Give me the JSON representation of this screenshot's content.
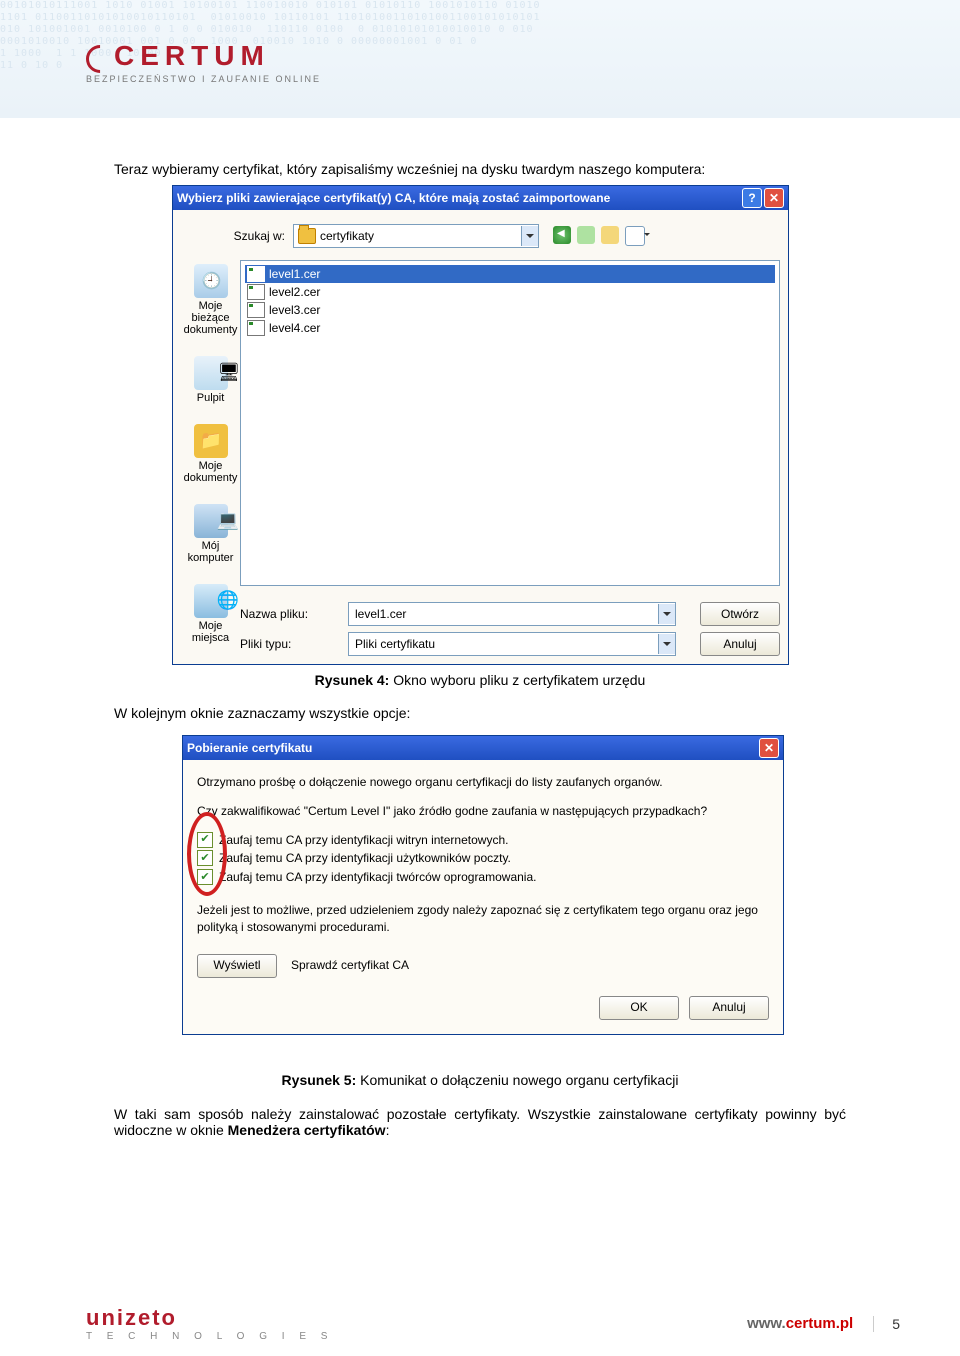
{
  "brand": {
    "certum": "CERTUM",
    "slogan": "BEZPIECZEŃSTWO I ZAUFANIE ONLINE",
    "unizeto": "unizeto",
    "unizeto_sub": "T E C H N O L O G I E S",
    "url_prefix": "www.",
    "url_main": "certum.pl"
  },
  "page_number": "5",
  "texts": {
    "intro": "Teraz wybieramy certyfikat, który zapisaliśmy wcześniej na dysku twardym naszego komputera:",
    "caption1_a": "Rysunek 4:",
    "caption1_b": " Okno wyboru pliku z certyfikatem urzędu",
    "mid": "W kolejnym oknie zaznaczamy wszystkie opcje:",
    "caption2_a": "Rysunek 5:",
    "caption2_b": " Komunikat o dołączeniu nowego organu certyfikacji",
    "outro_a": "W taki sam sposób należy zainstalować pozostałe certyfikaty. Wszystkie zainstalowane certyfikaty powinny być widoczne w oknie ",
    "outro_b": "Menedżera certyfikatów",
    "outro_c": ":"
  },
  "dialog1": {
    "title": "Wybierz pliki zawierające certyfikat(y) CA, które mają zostać zaimportowane",
    "lookin_label": "Szukaj w:",
    "lookin_value": "certyfikaty",
    "places": {
      "recent": "Moje bieżące dokumenty",
      "desktop": "Pulpit",
      "docs": "Moje dokumenty",
      "comp": "Mój komputer",
      "net": "Moje miejsca"
    },
    "files": [
      "level1.cer",
      "level2.cer",
      "level3.cer",
      "level4.cer"
    ],
    "filename_label": "Nazwa pliku:",
    "filename_value": "level1.cer",
    "filetype_label": "Pliki typu:",
    "filetype_value": "Pliki certyfikatu",
    "open": "Otwórz",
    "cancel": "Anuluj"
  },
  "dialog2": {
    "title": "Pobieranie certyfikatu",
    "p1": "Otrzymano prośbę o dołączenie nowego organu certyfikacji do listy zaufanych organów.",
    "q": "Czy zakwalifikować \"Certum Level I\" jako źródło godne zaufania w następujących przypadkach?",
    "c1": "Zaufaj temu CA przy identyfikacji witryn internetowych.",
    "c2": "Zaufaj temu CA przy identyfikacji użytkowników poczty.",
    "c3": "Zaufaj temu CA przy identyfikacji twórców oprogramowania.",
    "p2": "Jeżeli jest to możliwe, przed udzieleniem zgody należy zapoznać się z certyfikatem tego organu oraz jego polityką i stosowanymi procedurami.",
    "view": "Wyświetl",
    "view_hint": "Sprawdź certyfikat CA",
    "ok": "OK",
    "cancel": "Anuluj"
  }
}
